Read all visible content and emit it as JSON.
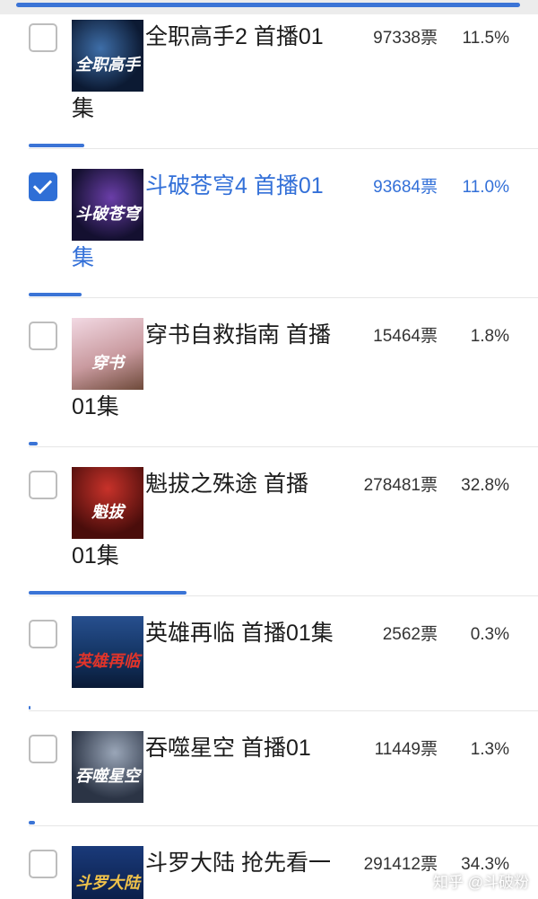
{
  "options": [
    {
      "title_line1": "全职高手2 首播01",
      "title_line2": "集",
      "votes": "97338票",
      "percent": "11.5%",
      "share": 0.115,
      "checked": false,
      "thumb_text": "全职高手"
    },
    {
      "title_line1": "斗破苍穹4 首播01",
      "title_line2": "集",
      "votes": "93684票",
      "percent": "11.0%",
      "share": 0.11,
      "checked": true,
      "thumb_text": "斗破苍穹"
    },
    {
      "title_line1": "穿书自救指南 首播",
      "title_line2": "01集",
      "votes": "15464票",
      "percent": "1.8%",
      "share": 0.018,
      "checked": false,
      "thumb_text": "穿书"
    },
    {
      "title_line1": "魁拔之殊途 首播",
      "title_line2": "01集",
      "votes": "278481票",
      "percent": "32.8%",
      "share": 0.328,
      "checked": false,
      "thumb_text": "魁拔"
    },
    {
      "title_line1": "英雄再临 首播01集",
      "title_line2": "",
      "votes": "2562票",
      "percent": "0.3%",
      "share": 0.003,
      "checked": false,
      "thumb_text": "英雄再临"
    },
    {
      "title_line1": "吞噬星空 首播01",
      "title_line2": "",
      "votes": "11449票",
      "percent": "1.3%",
      "share": 0.013,
      "checked": false,
      "thumb_text": "吞噬星空"
    },
    {
      "title_line1": "斗罗大陆 抢先看一",
      "title_line2": "",
      "votes": "291412票",
      "percent": "34.3%",
      "share": 0.343,
      "checked": false,
      "thumb_text": "斗罗大陆"
    }
  ],
  "watermark": "知乎 @斗破粉"
}
